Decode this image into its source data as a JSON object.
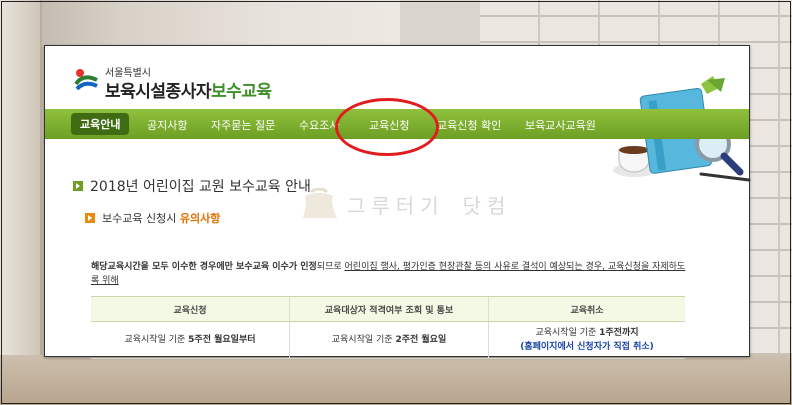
{
  "logo": {
    "city": "서울특별시",
    "title_main": "보육시설종사자",
    "title_accent": "보수교육"
  },
  "nav": {
    "items": [
      {
        "label": "교육안내",
        "active": true
      },
      {
        "label": "공지사항"
      },
      {
        "label": "자주묻는 질문"
      },
      {
        "label": "수요조사"
      },
      {
        "label": "교육신청"
      },
      {
        "label": "교육신청 확인"
      },
      {
        "label": "보육교사교육원"
      }
    ]
  },
  "page_title": "2018년 어린이집 교원 보수교육 안내",
  "subtitle": {
    "prefix": "보수교육 신청시 ",
    "accent": "유의사항"
  },
  "watermark": "그루터기 닷컴",
  "notice": {
    "part1": "해당교육시간을 모두 이수한 경우에만 보수교육 이수가 인정",
    "part2": "되므로 ",
    "part3": "어린이집 행사, 평가인증 현장관찰 등의 사유로 결석이 예상되는 경우, 교육신청을 자제하도록 위해"
  },
  "table": {
    "headers": [
      "교육신청",
      "교육대상자 적격여부 조회 및 통보",
      "교육취소"
    ],
    "col1": {
      "pre": "교육시작일 기준 ",
      "bold": "5주전 월요일부터"
    },
    "col2": {
      "pre": "교육시작일 기준 ",
      "bold": "2주전 월요일"
    },
    "col3": {
      "pre": "교육시작일 기준 ",
      "bold": "1주전까지",
      "note": "(홈페이지에서 신청자가 직접 취소)"
    }
  },
  "colors": {
    "nav_green": "#7bae2d",
    "active_tab": "#3f6b12",
    "accent_orange": "#e07000",
    "highlight_red": "#e21c1c",
    "note_blue": "#1a44a8"
  }
}
